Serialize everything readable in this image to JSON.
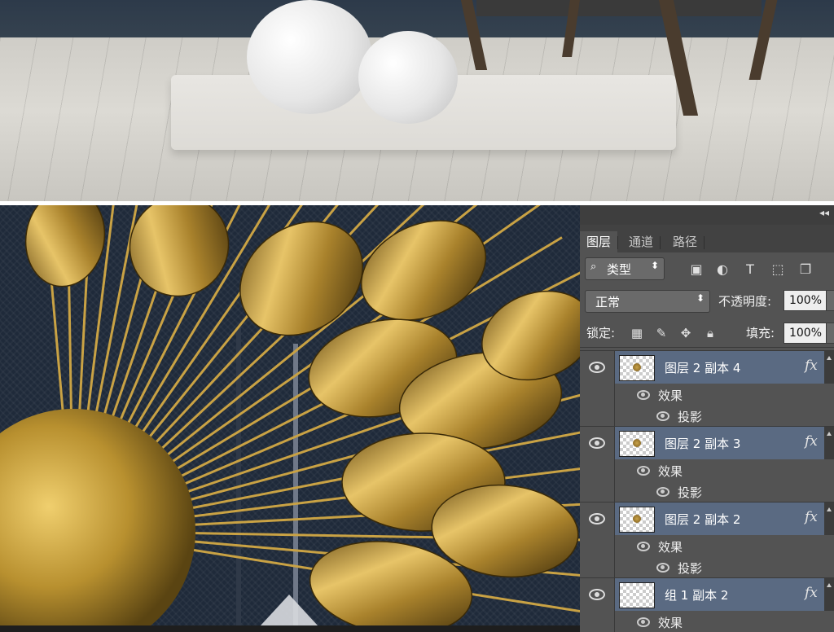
{
  "panel": {
    "collapse_icon": "double-chevron-left-icon",
    "tabs": [
      {
        "label": "图层",
        "active": true
      },
      {
        "label": "通道",
        "active": false
      },
      {
        "label": "路径",
        "active": false
      }
    ],
    "filter": {
      "label": "类型",
      "icon": "search-icon"
    },
    "filter_icons": [
      "image-filter-icon",
      "adjustment-filter-icon",
      "type-filter-icon",
      "shape-filter-icon",
      "smart-object-filter-icon"
    ],
    "blend_mode": "正常",
    "opacity_label": "不透明度:",
    "opacity_value": "100%",
    "lock_label": "锁定:",
    "lock_icons": [
      "lock-transparent-icon",
      "lock-paint-icon",
      "lock-position-icon",
      "lock-all-icon"
    ],
    "fill_label": "填充:",
    "fill_value": "100%",
    "layers": [
      {
        "name": "图层 2 副本 4",
        "fx": "fx",
        "effects_label": "效果",
        "effect": "投影"
      },
      {
        "name": "图层 2 副本 3",
        "fx": "fx",
        "effects_label": "效果",
        "effect": "投影"
      },
      {
        "name": "图层 2 副本 2",
        "fx": "fx",
        "effects_label": "效果",
        "effect": "投影"
      },
      {
        "name": "组 1 副本 2",
        "fx": "fx",
        "effects_label": "效果"
      }
    ]
  },
  "colors": {
    "panel_bg": "#535353",
    "selected_layer": "#5a6a82",
    "gold": "#b08a34",
    "wall": "#2d3a4a"
  }
}
